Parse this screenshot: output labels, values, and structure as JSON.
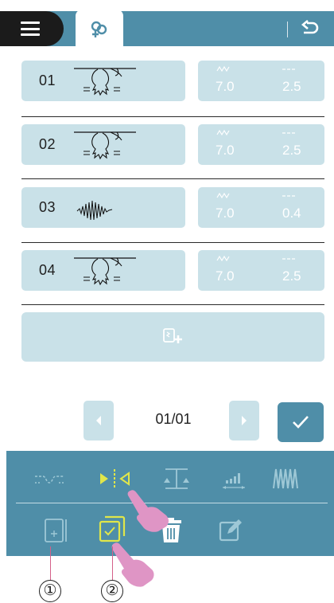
{
  "header": {
    "menu_icon": "hamburger-menu-icon",
    "active_tab_icon": "stitch-combination-icon",
    "back_icon": "undo-back-icon"
  },
  "param_icons": {
    "width": "stitch-width-icon",
    "length": "stitch-length-icon"
  },
  "stitches": [
    {
      "number": "01",
      "icon": "applique-bear-stitch-icon",
      "width": "7.0",
      "length": "2.5"
    },
    {
      "number": "02",
      "icon": "applique-bear-stitch-icon",
      "width": "7.0",
      "length": "2.5"
    },
    {
      "number": "03",
      "icon": "satin-zigzag-stitch-icon",
      "width": "7.0",
      "length": "0.4"
    },
    {
      "number": "04",
      "icon": "applique-bear-stitch-icon",
      "width": "7.0",
      "length": "2.5"
    }
  ],
  "add_button_icon": "add-stitch-icon",
  "pager": {
    "text": "01/01",
    "prev_icon": "chevron-left-icon",
    "next_icon": "chevron-right-icon"
  },
  "confirm_icon": "checkmark-icon",
  "tools_row1": [
    "connect-stitch-icon",
    "mirror-image-icon",
    "balance-icon",
    "elongation-icon",
    "density-icon"
  ],
  "tools_row2": [
    "insert-icon",
    "select-all-icon",
    "delete-icon",
    "edit-icon"
  ],
  "callouts": [
    "①",
    "②"
  ],
  "colors": {
    "accent": "#4f8ea8",
    "row_bg": "#c9e1e8",
    "highlight": "#e0e64a",
    "hand": "#df95c5",
    "dark": "#1b1b1b"
  }
}
